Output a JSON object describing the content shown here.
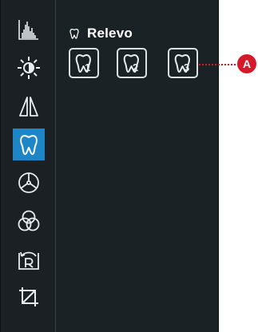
{
  "panel": {
    "title": "Relevo",
    "title_icon": "tooth-icon"
  },
  "toolbar": {
    "items": [
      {
        "icon": "histogram-icon"
      },
      {
        "icon": "brightness-icon"
      },
      {
        "icon": "sharpen-icon"
      },
      {
        "icon": "tooth-relief-icon",
        "active": true
      },
      {
        "icon": "color-wheel-icon"
      },
      {
        "icon": "color-channels-icon"
      },
      {
        "icon": "rotate-icon"
      },
      {
        "icon": "crop-icon"
      }
    ]
  },
  "presets": [
    {
      "label": "1"
    },
    {
      "label": "2"
    },
    {
      "label": "3"
    }
  ],
  "callout": {
    "label": "A",
    "color": "#d3192a"
  },
  "colors": {
    "panel_bg": "#1b2226",
    "active_accent": "#1e86c6",
    "icon_stroke": "#e6ecef"
  }
}
